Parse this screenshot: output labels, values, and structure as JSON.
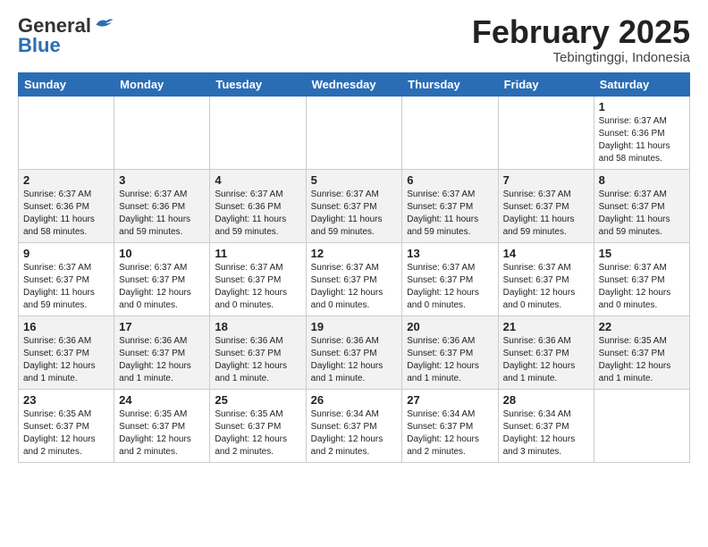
{
  "header": {
    "logo_general": "General",
    "logo_blue": "Blue",
    "month_title": "February 2025",
    "location": "Tebingtinggi, Indonesia"
  },
  "days_of_week": [
    "Sunday",
    "Monday",
    "Tuesday",
    "Wednesday",
    "Thursday",
    "Friday",
    "Saturday"
  ],
  "weeks": [
    [
      {
        "day": "",
        "info": ""
      },
      {
        "day": "",
        "info": ""
      },
      {
        "day": "",
        "info": ""
      },
      {
        "day": "",
        "info": ""
      },
      {
        "day": "",
        "info": ""
      },
      {
        "day": "",
        "info": ""
      },
      {
        "day": "1",
        "info": "Sunrise: 6:37 AM\nSunset: 6:36 PM\nDaylight: 11 hours\nand 58 minutes."
      }
    ],
    [
      {
        "day": "2",
        "info": "Sunrise: 6:37 AM\nSunset: 6:36 PM\nDaylight: 11 hours\nand 58 minutes."
      },
      {
        "day": "3",
        "info": "Sunrise: 6:37 AM\nSunset: 6:36 PM\nDaylight: 11 hours\nand 59 minutes."
      },
      {
        "day": "4",
        "info": "Sunrise: 6:37 AM\nSunset: 6:36 PM\nDaylight: 11 hours\nand 59 minutes."
      },
      {
        "day": "5",
        "info": "Sunrise: 6:37 AM\nSunset: 6:37 PM\nDaylight: 11 hours\nand 59 minutes."
      },
      {
        "day": "6",
        "info": "Sunrise: 6:37 AM\nSunset: 6:37 PM\nDaylight: 11 hours\nand 59 minutes."
      },
      {
        "day": "7",
        "info": "Sunrise: 6:37 AM\nSunset: 6:37 PM\nDaylight: 11 hours\nand 59 minutes."
      },
      {
        "day": "8",
        "info": "Sunrise: 6:37 AM\nSunset: 6:37 PM\nDaylight: 11 hours\nand 59 minutes."
      }
    ],
    [
      {
        "day": "9",
        "info": "Sunrise: 6:37 AM\nSunset: 6:37 PM\nDaylight: 11 hours\nand 59 minutes."
      },
      {
        "day": "10",
        "info": "Sunrise: 6:37 AM\nSunset: 6:37 PM\nDaylight: 12 hours\nand 0 minutes."
      },
      {
        "day": "11",
        "info": "Sunrise: 6:37 AM\nSunset: 6:37 PM\nDaylight: 12 hours\nand 0 minutes."
      },
      {
        "day": "12",
        "info": "Sunrise: 6:37 AM\nSunset: 6:37 PM\nDaylight: 12 hours\nand 0 minutes."
      },
      {
        "day": "13",
        "info": "Sunrise: 6:37 AM\nSunset: 6:37 PM\nDaylight: 12 hours\nand 0 minutes."
      },
      {
        "day": "14",
        "info": "Sunrise: 6:37 AM\nSunset: 6:37 PM\nDaylight: 12 hours\nand 0 minutes."
      },
      {
        "day": "15",
        "info": "Sunrise: 6:37 AM\nSunset: 6:37 PM\nDaylight: 12 hours\nand 0 minutes."
      }
    ],
    [
      {
        "day": "16",
        "info": "Sunrise: 6:36 AM\nSunset: 6:37 PM\nDaylight: 12 hours\nand 1 minute."
      },
      {
        "day": "17",
        "info": "Sunrise: 6:36 AM\nSunset: 6:37 PM\nDaylight: 12 hours\nand 1 minute."
      },
      {
        "day": "18",
        "info": "Sunrise: 6:36 AM\nSunset: 6:37 PM\nDaylight: 12 hours\nand 1 minute."
      },
      {
        "day": "19",
        "info": "Sunrise: 6:36 AM\nSunset: 6:37 PM\nDaylight: 12 hours\nand 1 minute."
      },
      {
        "day": "20",
        "info": "Sunrise: 6:36 AM\nSunset: 6:37 PM\nDaylight: 12 hours\nand 1 minute."
      },
      {
        "day": "21",
        "info": "Sunrise: 6:36 AM\nSunset: 6:37 PM\nDaylight: 12 hours\nand 1 minute."
      },
      {
        "day": "22",
        "info": "Sunrise: 6:35 AM\nSunset: 6:37 PM\nDaylight: 12 hours\nand 1 minute."
      }
    ],
    [
      {
        "day": "23",
        "info": "Sunrise: 6:35 AM\nSunset: 6:37 PM\nDaylight: 12 hours\nand 2 minutes."
      },
      {
        "day": "24",
        "info": "Sunrise: 6:35 AM\nSunset: 6:37 PM\nDaylight: 12 hours\nand 2 minutes."
      },
      {
        "day": "25",
        "info": "Sunrise: 6:35 AM\nSunset: 6:37 PM\nDaylight: 12 hours\nand 2 minutes."
      },
      {
        "day": "26",
        "info": "Sunrise: 6:34 AM\nSunset: 6:37 PM\nDaylight: 12 hours\nand 2 minutes."
      },
      {
        "day": "27",
        "info": "Sunrise: 6:34 AM\nSunset: 6:37 PM\nDaylight: 12 hours\nand 2 minutes."
      },
      {
        "day": "28",
        "info": "Sunrise: 6:34 AM\nSunset: 6:37 PM\nDaylight: 12 hours\nand 3 minutes."
      },
      {
        "day": "",
        "info": ""
      }
    ]
  ]
}
